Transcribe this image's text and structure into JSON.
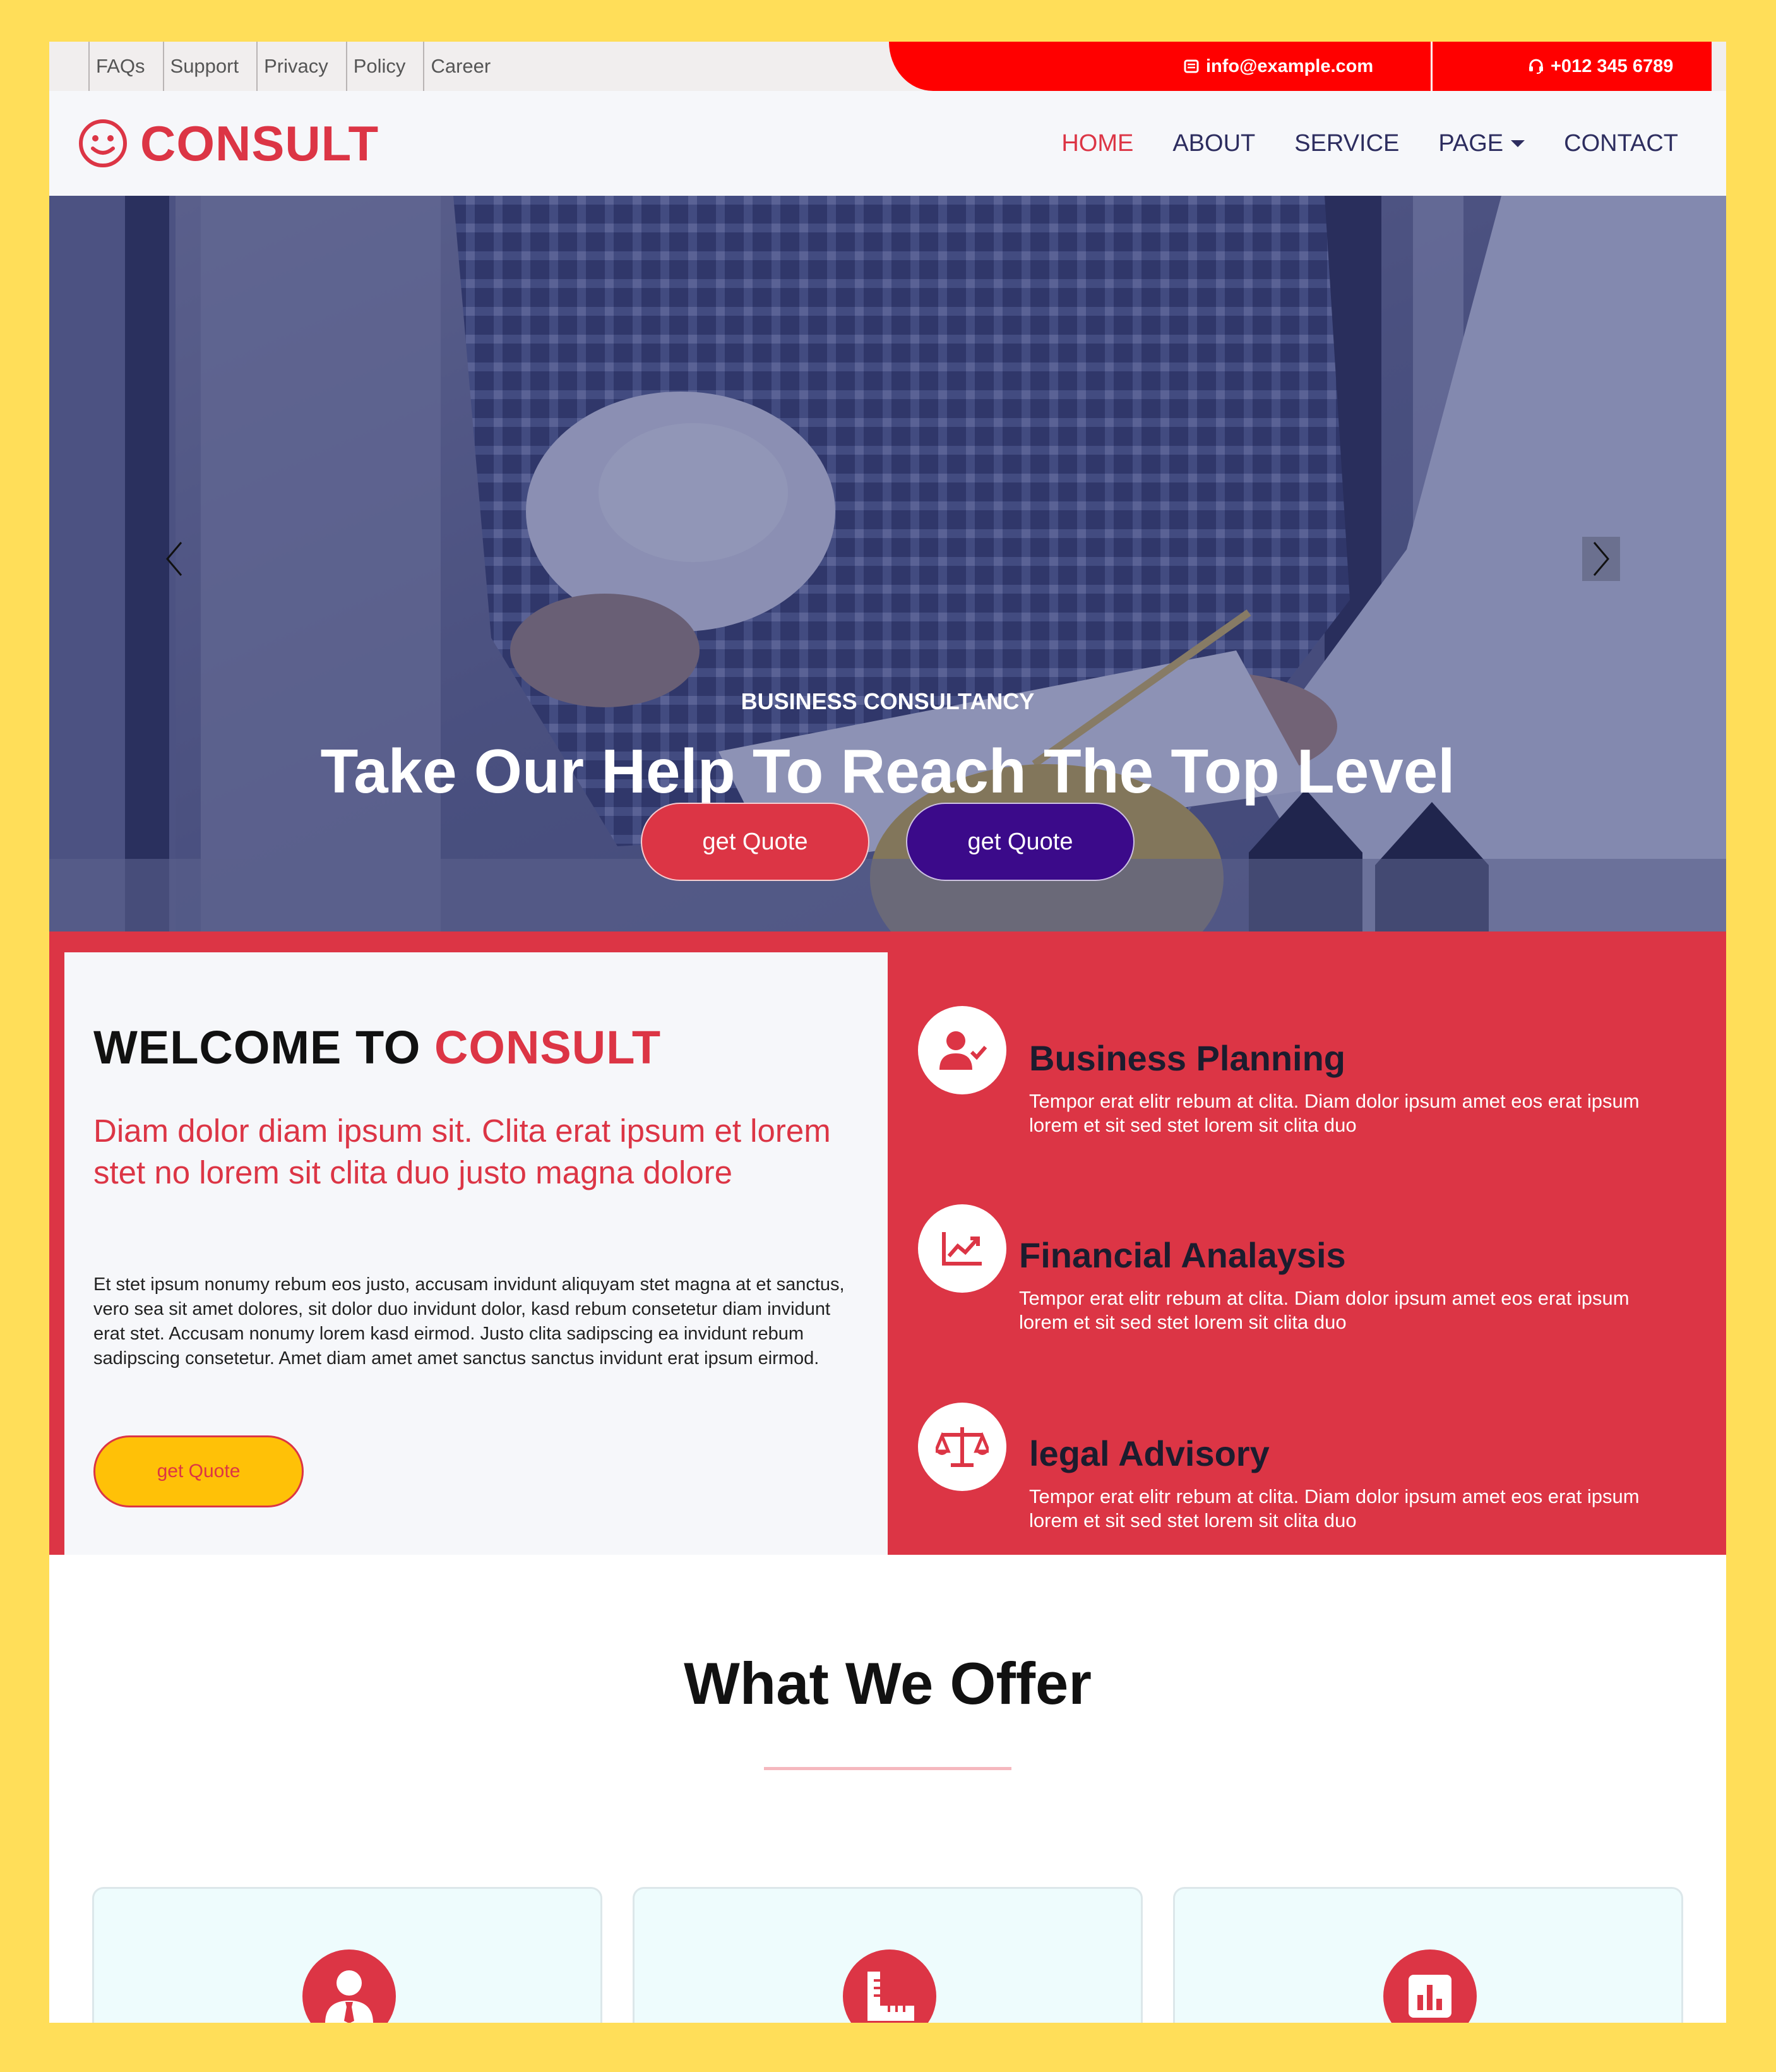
{
  "topbar": {
    "links": [
      "FAQs",
      "Support",
      "Privacy",
      "Policy",
      "Career"
    ],
    "email": "info@example.com",
    "phone": "+012 345 6789"
  },
  "nav": {
    "brand": "CONSULT",
    "items": [
      "HOME",
      "ABOUT",
      "SERVICE",
      "PAGE",
      "CONTACT"
    ],
    "active": "HOME"
  },
  "hero": {
    "kicker": "BUSINESS CONSULTANCY",
    "title": "Take Our Help To Reach The Top Level",
    "button_primary": "get Quote",
    "button_secondary": "get Quote",
    "slides": 3,
    "active_slide": 1
  },
  "welcome": {
    "heading_prefix": "WELCOME TO",
    "heading_accent": "CONSULT",
    "lead": "Diam dolor diam ipsum sit. Clita erat ipsum et lorem stet no lorem sit clita duo justo magna dolore",
    "body": "Et stet ipsum nonumy rebum eos justo, accusam invidunt aliquyam stet magna at et sanctus, vero sea sit amet dolores, sit dolor duo invidunt dolor, kasd rebum consetetur diam invidunt erat stet. Accusam nonumy lorem kasd eirmod. Justo clita sadipscing ea invidunt rebum sadipscing consetetur. Amet diam amet amet sanctus sanctus invidunt erat ipsum eirmod.",
    "button": "get Quote"
  },
  "services": [
    {
      "title": "Business Planning",
      "text": "Tempor erat elitr rebum at clita. Diam dolor ipsum amet eos erat ipsum lorem et sit sed stet lorem sit clita duo",
      "icon": "user-check-icon"
    },
    {
      "title": "Financial Analaysis",
      "text": "Tempor erat elitr rebum at clita. Diam dolor ipsum amet eos erat ipsum lorem et sit sed stet lorem sit clita duo",
      "icon": "chart-line-icon"
    },
    {
      "title": "legal Advisory",
      "text": "Tempor erat elitr rebum at clita. Diam dolor ipsum amet eos erat ipsum lorem et sit sed stet lorem sit clita duo",
      "icon": "balance-scale-icon"
    }
  ],
  "offer": {
    "heading": "What We Offer",
    "cards": [
      {
        "icon": "user-tie-icon"
      },
      {
        "icon": "pencil-ruler-icon"
      },
      {
        "icon": "chart-bar-icon"
      }
    ]
  },
  "colors": {
    "primary": "#dc3545",
    "secondary": "#3b0a8a",
    "warning": "#ffc107",
    "topbar_red": "#ff0000",
    "frame": "#FFDE59"
  }
}
